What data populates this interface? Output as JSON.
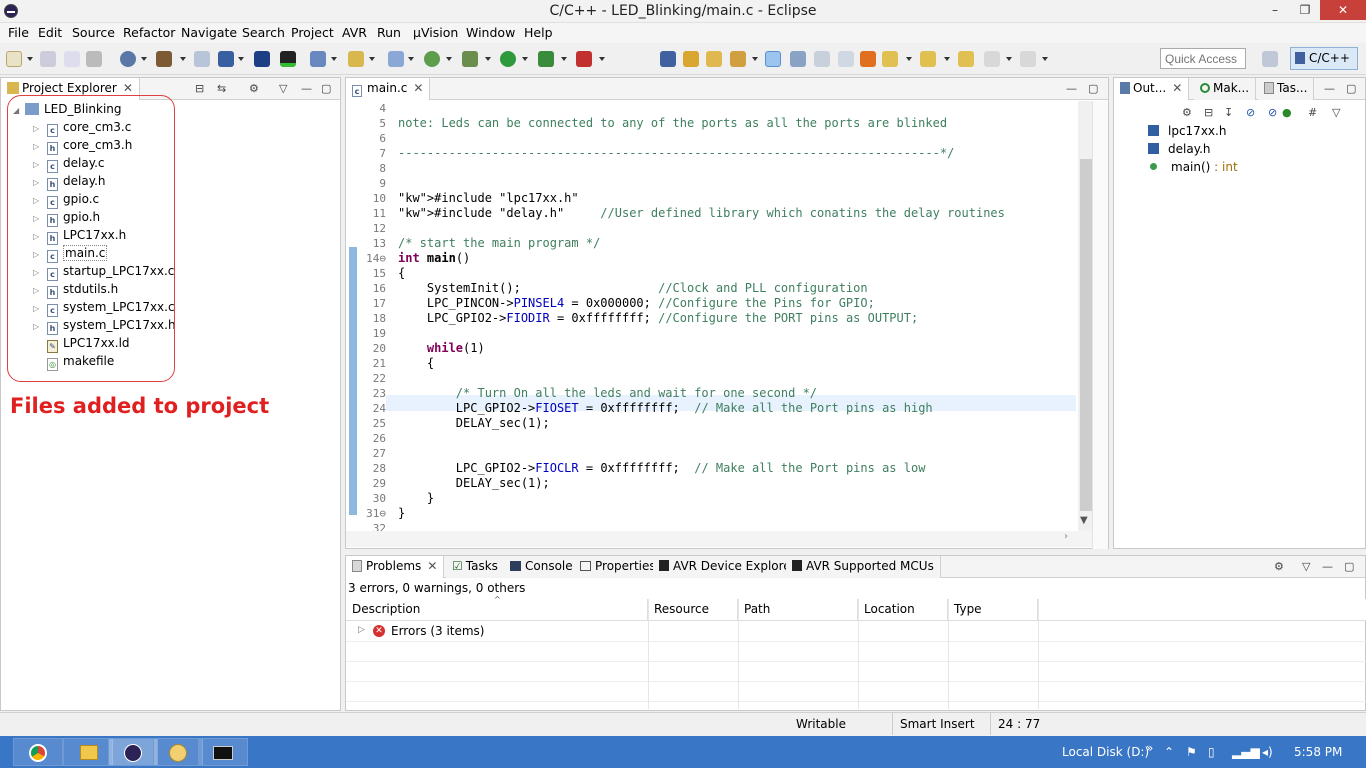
{
  "window": {
    "title": "C/C++ - LED_Blinking/main.c - Eclipse",
    "minimize": "–",
    "maximize": "❐",
    "close": "✕"
  },
  "menu": [
    "File",
    "Edit",
    "Source",
    "Refactor",
    "Navigate",
    "Search",
    "Project",
    "AVR",
    "Run",
    "µVision",
    "Window",
    "Help"
  ],
  "toolbar": {
    "quick_access_placeholder": "Quick Access",
    "perspective": "C/C++"
  },
  "project_explorer": {
    "tab": "Project Explorer",
    "project": "LED_Blinking",
    "files": [
      {
        "name": "core_cm3.c",
        "type": "c"
      },
      {
        "name": "core_cm3.h",
        "type": "h"
      },
      {
        "name": "delay.c",
        "type": "c"
      },
      {
        "name": "delay.h",
        "type": "h"
      },
      {
        "name": "gpio.c",
        "type": "c"
      },
      {
        "name": "gpio.h",
        "type": "h"
      },
      {
        "name": "LPC17xx.h",
        "type": "h"
      },
      {
        "name": "main.c",
        "type": "c"
      },
      {
        "name": "startup_LPC17xx.c",
        "type": "c"
      },
      {
        "name": "stdutils.h",
        "type": "h"
      },
      {
        "name": "system_LPC17xx.c",
        "type": "c"
      },
      {
        "name": "system_LPC17xx.h",
        "type": "h"
      },
      {
        "name": "LPC17xx.ld",
        "type": "ld"
      },
      {
        "name": "makefile",
        "type": "mk"
      }
    ],
    "annotation": "Files added to project"
  },
  "editor": {
    "tab": "main.c",
    "lines": [
      {
        "n": "4",
        "t": ""
      },
      {
        "n": "5",
        "t": "note: Leds can be connected to any of the ports as all the ports are blinked",
        "c": "com"
      },
      {
        "n": "6",
        "t": ""
      },
      {
        "n": "7",
        "t": "---------------------------------------------------------------------------*/",
        "c": "com"
      },
      {
        "n": "8",
        "t": ""
      },
      {
        "n": "9",
        "t": ""
      },
      {
        "n": "10",
        "t": "#include \"lpc17xx.h\"",
        "c": "inc"
      },
      {
        "n": "11",
        "t": "#include \"delay.h\"     //User defined library which conatins the delay routines",
        "c": "inc2"
      },
      {
        "n": "12",
        "t": ""
      },
      {
        "n": "13",
        "t": "/* start the main program */",
        "c": "com"
      },
      {
        "n": "14⊖",
        "t": "int main()",
        "c": "main"
      },
      {
        "n": "15",
        "t": "{"
      },
      {
        "n": "16",
        "t": "    SystemInit();                   //Clock and PLL configuration",
        "c": "cmt"
      },
      {
        "n": "17",
        "t": "    LPC_PINCON->PINSEL4 = 0x000000; //Configure the Pins for GPIO;",
        "c": "cmt"
      },
      {
        "n": "18",
        "t": "    LPC_GPIO2->FIODIR = 0xffffffff; //Configure the PORT pins as OUTPUT;",
        "c": "cmt"
      },
      {
        "n": "19",
        "t": ""
      },
      {
        "n": "20",
        "t": "    while(1)",
        "c": "while"
      },
      {
        "n": "21",
        "t": "    {"
      },
      {
        "n": "22",
        "t": ""
      },
      {
        "n": "23",
        "t": "        /* Turn On all the leds and wait for one second */",
        "c": "com"
      },
      {
        "n": "24",
        "t": "        LPC_GPIO2->FIOSET = 0xffffffff;  // Make all the Port pins as high",
        "c": "cmt"
      },
      {
        "n": "25",
        "t": "        DELAY_sec(1);"
      },
      {
        "n": "26",
        "t": ""
      },
      {
        "n": "27",
        "t": ""
      },
      {
        "n": "28",
        "t": "        LPC_GPIO2->FIOCLR = 0xffffffff;  // Make all the Port pins as low",
        "c": "cmt"
      },
      {
        "n": "29",
        "t": "        DELAY_sec(1);"
      },
      {
        "n": "30",
        "t": "    }"
      },
      {
        "n": "31⊖",
        "t": "}"
      },
      {
        "n": "32",
        "t": ""
      }
    ]
  },
  "outline": {
    "tabs": [
      "Out...",
      "Mak...",
      "Tas..."
    ],
    "items": [
      {
        "name": "lpc17xx.h"
      },
      {
        "name": "delay.h"
      },
      {
        "name": "main()",
        "suffix": " : int"
      }
    ]
  },
  "bottom": {
    "tabs": [
      "Problems",
      "Tasks",
      "Console",
      "Properties",
      "AVR Device Explorer",
      "AVR Supported MCUs"
    ],
    "summary": "3 errors, 0 warnings, 0 others",
    "columns": [
      "Description",
      "Resource",
      "Path",
      "Location",
      "Type"
    ],
    "errors_row": "Errors (3 items)"
  },
  "status": {
    "writable": "Writable",
    "insert": "Smart Insert",
    "position": "24 : 77"
  },
  "taskbar": {
    "disk": "Local Disk (D:)",
    "time": "5:58 PM",
    "chevron": "»"
  }
}
